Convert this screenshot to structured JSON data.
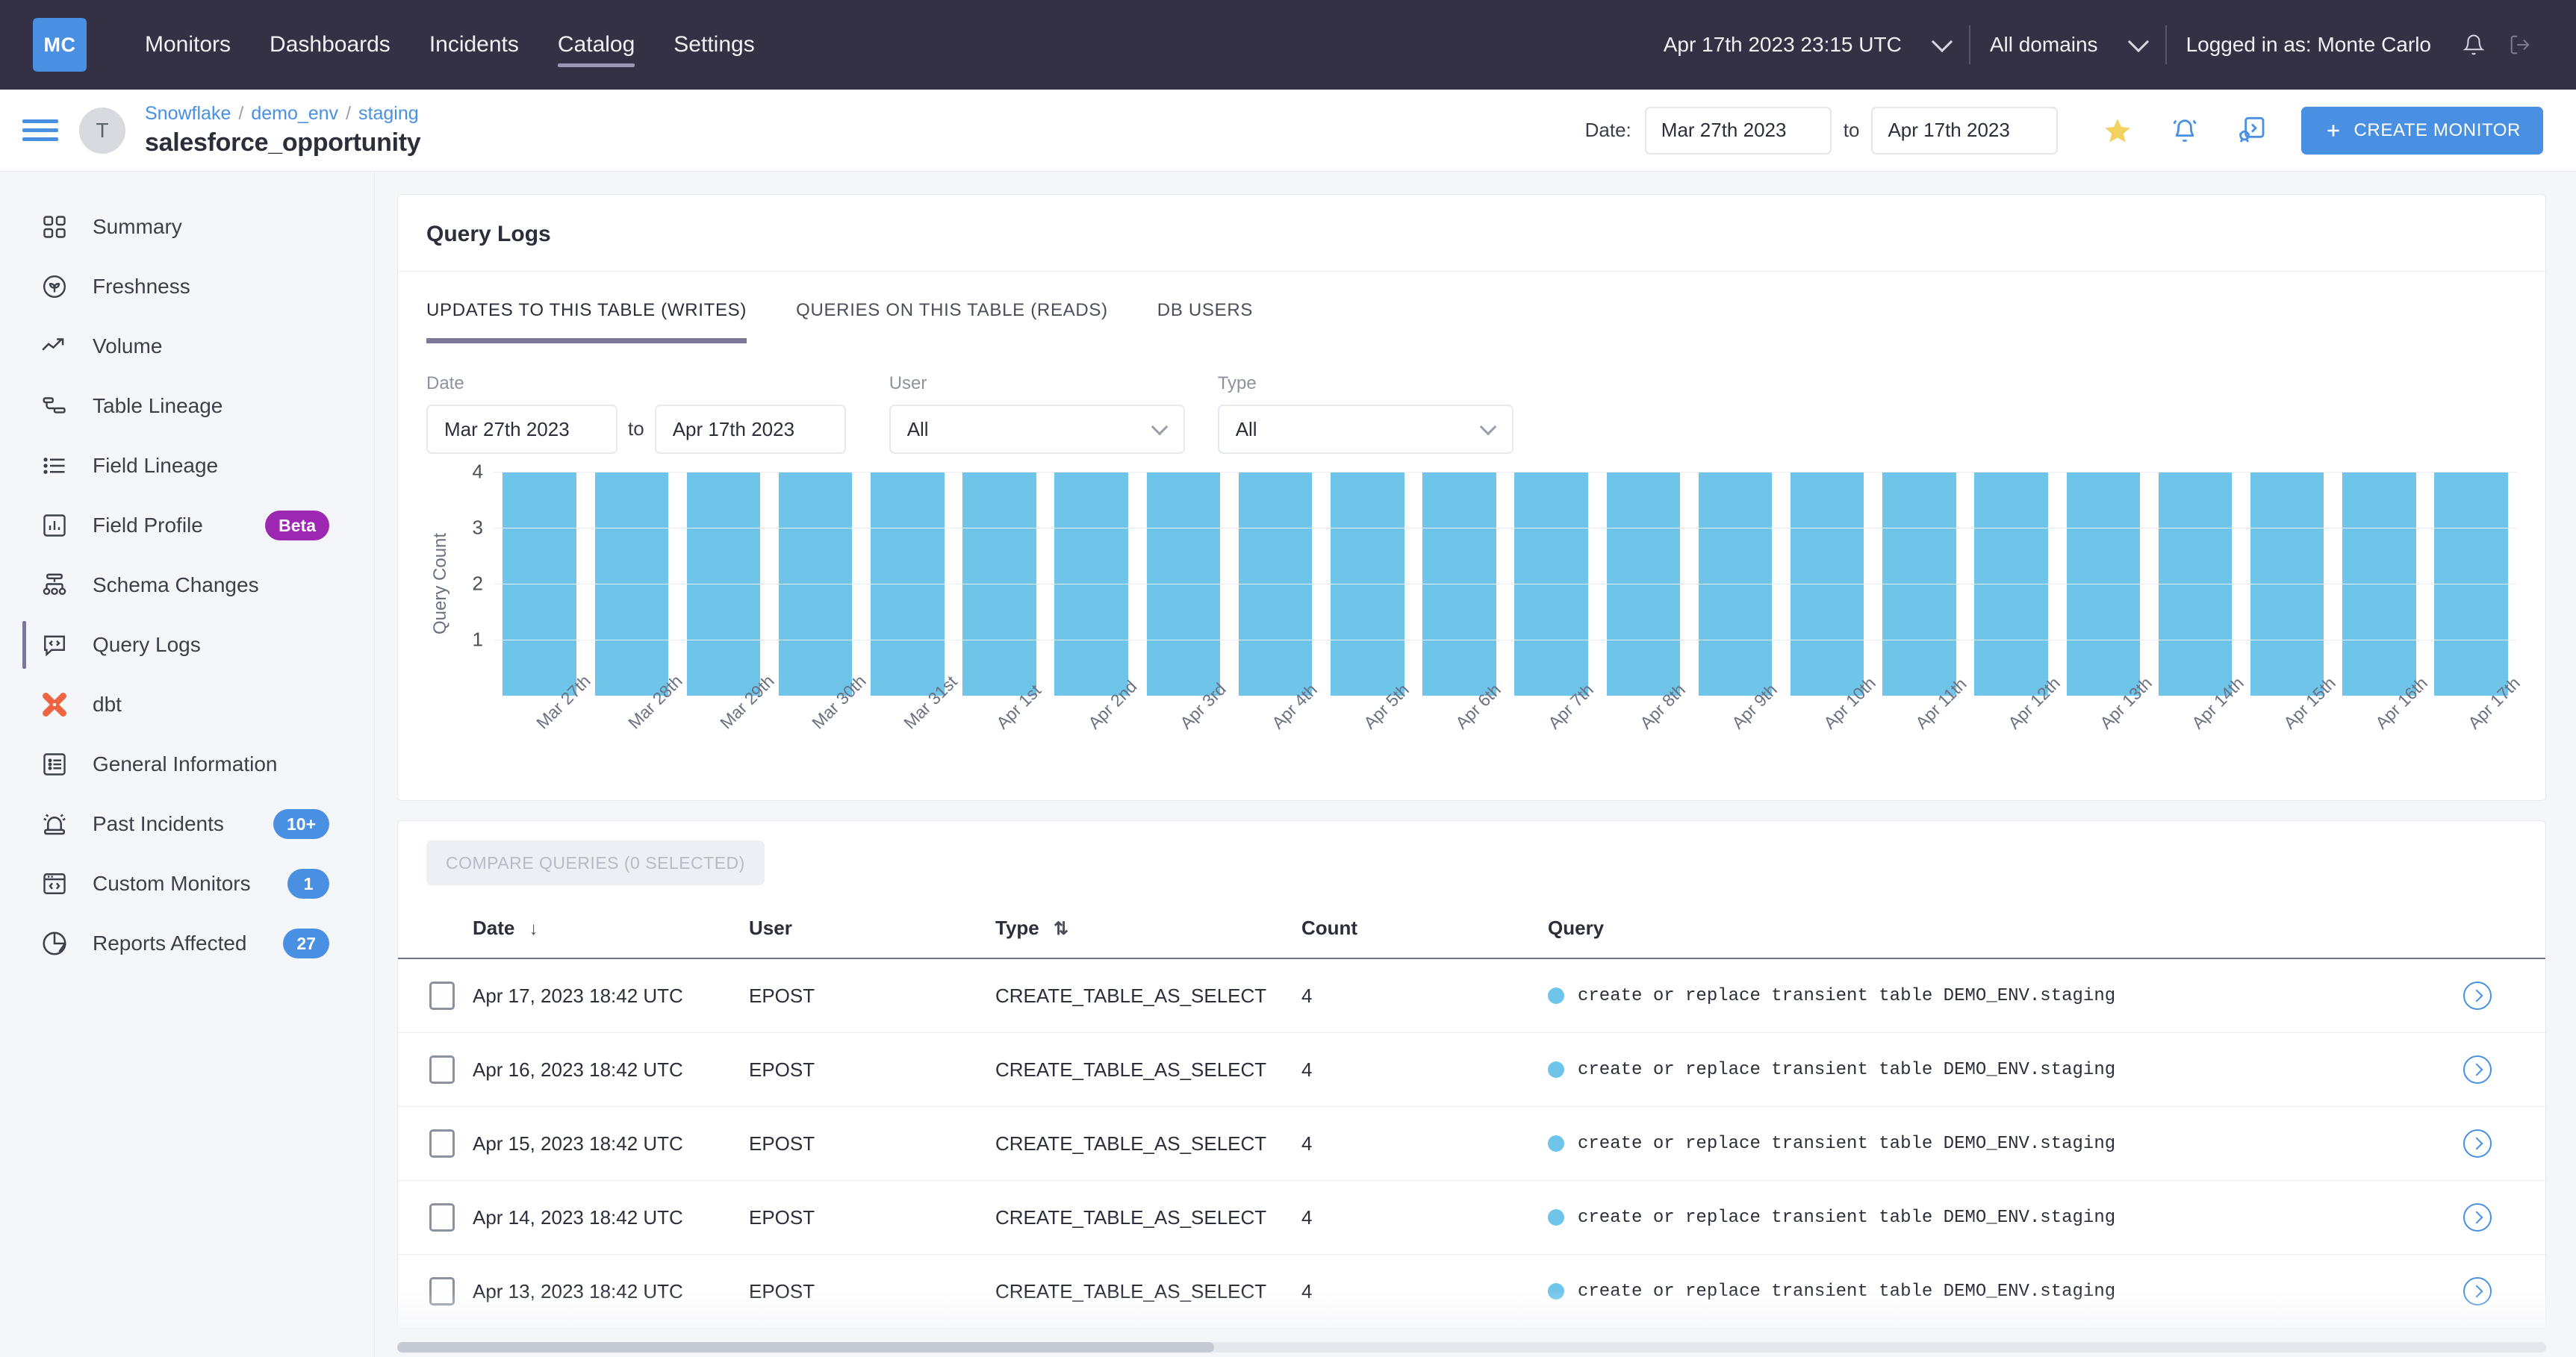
{
  "topnav": {
    "logo": "MC",
    "links": [
      {
        "label": "Monitors",
        "active": false
      },
      {
        "label": "Dashboards",
        "active": false
      },
      {
        "label": "Incidents",
        "active": false
      },
      {
        "label": "Catalog",
        "active": true
      },
      {
        "label": "Settings",
        "active": false
      }
    ],
    "timestamp": "Apr 17th 2023 23:15 UTC",
    "domain_selector": "All domains",
    "user_label": "Logged in as: Monte Carlo",
    "bell_icon": "bell-icon",
    "logout_icon": "logout-icon"
  },
  "header": {
    "avatar_letter": "T",
    "breadcrumb": [
      "Snowflake",
      "demo_env",
      "staging"
    ],
    "breadcrumb_separator": "/",
    "title": "salesforce_opportunity",
    "date_label": "Date:",
    "date_from": "Mar 27th 2023",
    "date_to": "Apr 17th 2023",
    "to_label": "to",
    "star_icon": "star-icon",
    "alert_icon": "bell-alert-icon",
    "incident_icon": "report-incident-icon",
    "create_monitor_label": "CREATE MONITOR",
    "plus_icon": "plus-icon"
  },
  "sidebar": {
    "items": [
      {
        "label": "Summary",
        "icon": "grid-icon",
        "active": false,
        "badge": null
      },
      {
        "label": "Freshness",
        "icon": "leaf-circle-icon",
        "active": false,
        "badge": null
      },
      {
        "label": "Volume",
        "icon": "trend-up-icon",
        "active": false,
        "badge": null
      },
      {
        "label": "Table Lineage",
        "icon": "table-lineage-icon",
        "active": false,
        "badge": null
      },
      {
        "label": "Field Lineage",
        "icon": "list-bullet-icon",
        "active": false,
        "badge": null
      },
      {
        "label": "Field Profile",
        "icon": "bar-chart-box-icon",
        "active": false,
        "badge": "Beta",
        "badge_style": "purple"
      },
      {
        "label": "Schema Changes",
        "icon": "schema-tree-icon",
        "active": false,
        "badge": null
      },
      {
        "label": "Query Logs",
        "icon": "code-bubble-icon",
        "active": true,
        "badge": null
      },
      {
        "label": "dbt",
        "icon": "dbt-icon",
        "active": false,
        "badge": null
      },
      {
        "label": "General Information",
        "icon": "info-list-icon",
        "active": false,
        "badge": null
      },
      {
        "label": "Past Incidents",
        "icon": "siren-icon",
        "active": false,
        "badge": "10+",
        "badge_style": "blue"
      },
      {
        "label": "Custom Monitors",
        "icon": "code-window-icon",
        "active": false,
        "badge": "1",
        "badge_style": "blue"
      },
      {
        "label": "Reports Affected",
        "icon": "pie-chart-icon",
        "active": false,
        "badge": "27",
        "badge_style": "blue"
      }
    ]
  },
  "main": {
    "card_title": "Query Logs",
    "tabs": [
      {
        "label": "UPDATES TO THIS TABLE (WRITES)",
        "active": true
      },
      {
        "label": "QUERIES ON THIS TABLE (READS)",
        "active": false
      },
      {
        "label": "DB USERS",
        "active": false
      }
    ],
    "filters": {
      "date_label": "Date",
      "date_from": "Mar 27th 2023",
      "date_to": "Apr 17th 2023",
      "to_label": "to",
      "user_label": "User",
      "user_value": "All",
      "type_label": "Type",
      "type_value": "All"
    },
    "compare_button": "COMPARE QUERIES (0 SELECTED)",
    "table": {
      "columns": [
        "Date",
        "User",
        "Type",
        "Count",
        "Query"
      ],
      "sort": {
        "Date": "desc-arrow",
        "Type": "sortable-arrows"
      },
      "rows": [
        {
          "date": "Apr 17, 2023 18:42 UTC",
          "user": "EPOST",
          "type": "CREATE_TABLE_AS_SELECT",
          "count": "4",
          "query": "create or replace transient table DEMO_ENV.staging"
        },
        {
          "date": "Apr 16, 2023 18:42 UTC",
          "user": "EPOST",
          "type": "CREATE_TABLE_AS_SELECT",
          "count": "4",
          "query": "create or replace transient table DEMO_ENV.staging"
        },
        {
          "date": "Apr 15, 2023 18:42 UTC",
          "user": "EPOST",
          "type": "CREATE_TABLE_AS_SELECT",
          "count": "4",
          "query": "create or replace transient table DEMO_ENV.staging"
        },
        {
          "date": "Apr 14, 2023 18:42 UTC",
          "user": "EPOST",
          "type": "CREATE_TABLE_AS_SELECT",
          "count": "4",
          "query": "create or replace transient table DEMO_ENV.staging"
        },
        {
          "date": "Apr 13, 2023 18:42 UTC",
          "user": "EPOST",
          "type": "CREATE_TABLE_AS_SELECT",
          "count": "4",
          "query": "create or replace transient table DEMO_ENV.staging"
        }
      ]
    }
  },
  "colors": {
    "nav_bg": "#343145",
    "accent_blue": "#4a90e2",
    "bar_blue": "#6fc4ea",
    "active_purple": "#7d7799",
    "beta_purple": "#9c27b0",
    "star_yellow": "#f2d25f",
    "dbt_orange": "#ef6543"
  },
  "chart_data": {
    "type": "bar",
    "title": "",
    "xlabel": "",
    "ylabel": "Query Count",
    "ylim": [
      0,
      4
    ],
    "yticks": [
      1,
      2,
      3,
      4
    ],
    "grid": true,
    "legend": "none",
    "categories": [
      "Mar 27th",
      "Mar 28th",
      "Mar 29th",
      "Mar 30th",
      "Mar 31st",
      "Apr 1st",
      "Apr 2nd",
      "Apr 3rd",
      "Apr 4th",
      "Apr 5th",
      "Apr 6th",
      "Apr 7th",
      "Apr 8th",
      "Apr 9th",
      "Apr 10th",
      "Apr 11th",
      "Apr 12th",
      "Apr 13th",
      "Apr 14th",
      "Apr 15th",
      "Apr 16th",
      "Apr 17th"
    ],
    "values": [
      4,
      4,
      4,
      4,
      4,
      4,
      4,
      4,
      4,
      4,
      4,
      4,
      4,
      4,
      4,
      4,
      4,
      4,
      4,
      4,
      4,
      4
    ],
    "series": [
      {
        "name": "Query Count",
        "values": [
          4,
          4,
          4,
          4,
          4,
          4,
          4,
          4,
          4,
          4,
          4,
          4,
          4,
          4,
          4,
          4,
          4,
          4,
          4,
          4,
          4,
          4
        ]
      }
    ]
  }
}
